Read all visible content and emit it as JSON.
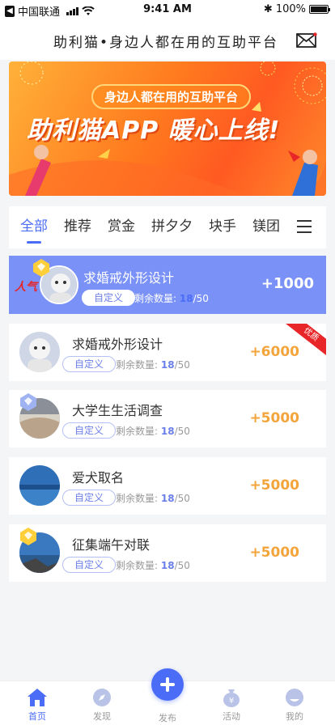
{
  "status_bar": {
    "carrier": "中国联通",
    "time": "9:41 AM",
    "battery": "100%"
  },
  "header": {
    "slogan": "助利猫•身边人都在用的互助平台"
  },
  "banner": {
    "pill": "身边人都在用的互助平台",
    "headline": "助利猫APP  暖心上线!"
  },
  "tabs": [
    "全部",
    "推荐",
    "赏金",
    "拼夕夕",
    "块手",
    "镁团"
  ],
  "list": {
    "remain_label": "剩余数量:",
    "items": [
      {
        "hot": "人气",
        "title": "求婚戒外形设计",
        "tag": "自定义",
        "remain": "18",
        "total": "/50",
        "reward": "+1000"
      },
      {
        "title": "求婚戒外形设计",
        "tag": "自定义",
        "remain": "18",
        "total": "/50",
        "reward": "+6000",
        "ribbon": "优质"
      },
      {
        "title": "大学生生活调查",
        "tag": "自定义",
        "remain": "18",
        "total": "/50",
        "reward": "+5000"
      },
      {
        "title": "爱犬取名",
        "tag": "自定义",
        "remain": "18",
        "total": "/50",
        "reward": "+5000"
      },
      {
        "title": "征集端午对联",
        "tag": "自定义",
        "remain": "18",
        "total": "/50",
        "reward": "+5000"
      }
    ]
  },
  "bottom_nav": [
    {
      "label": "首页",
      "icon": "home-icon"
    },
    {
      "label": "发现",
      "icon": "compass-icon"
    },
    {
      "label": "发布",
      "icon": "plus-icon"
    },
    {
      "label": "活动",
      "icon": "money-bag-icon"
    },
    {
      "label": "我的",
      "icon": "user-icon"
    }
  ],
  "colors": {
    "primary": "#4a6cf7",
    "reward": "#f3a43b",
    "highlight_card": "#7a91f8",
    "ribbon": "#e8262a"
  }
}
